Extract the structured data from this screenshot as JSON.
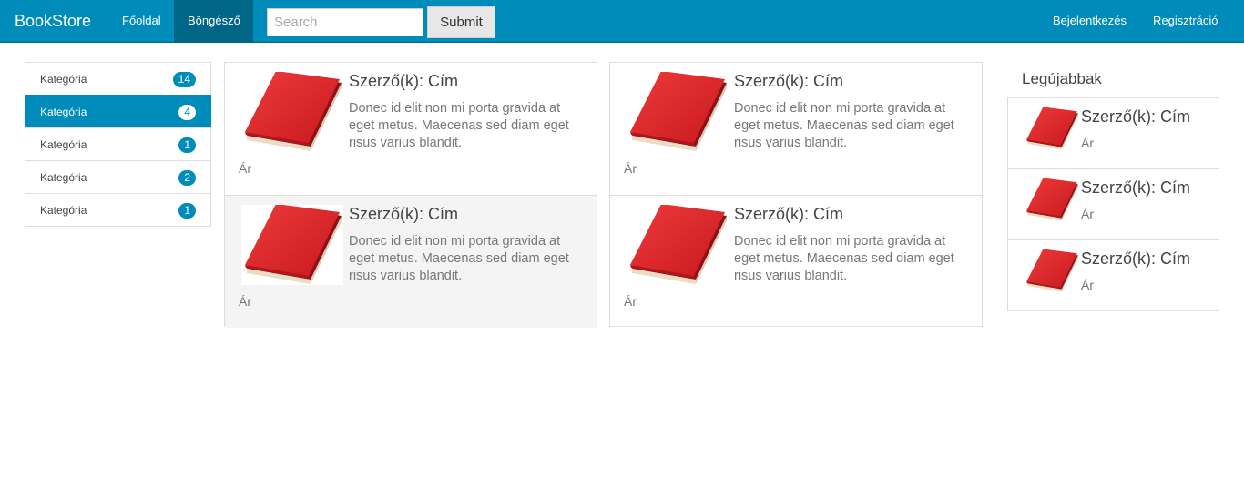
{
  "navbar": {
    "brand": "BookStore",
    "links": [
      "Főoldal",
      "Böngésző"
    ],
    "active_link": "Böngésző",
    "search_placeholder": "Search",
    "search_value": "",
    "submit_label": "Submit",
    "right_links": [
      "Bejelentkezés",
      "Regisztráció"
    ],
    "accent_color": "#008cba"
  },
  "sidebar": {
    "categories": [
      {
        "label": "Kategória",
        "count": "14",
        "active": false
      },
      {
        "label": "Kategória",
        "count": "4",
        "active": true
      },
      {
        "label": "Kategória",
        "count": "1",
        "active": false
      },
      {
        "label": "Kategória",
        "count": "2",
        "active": false
      },
      {
        "label": "Kategória",
        "count": "1",
        "active": false
      }
    ]
  },
  "books": [
    {
      "title": "Szerző(k): Cím",
      "description": "Donec id elit non mi porta gravida at eget metus. Maecenas sed diam eget risus varius blandit.",
      "price": "Ár",
      "image": "red-book-image"
    },
    {
      "title": "Szerző(k): Cím",
      "description": "Donec id elit non mi porta gravida at eget metus. Maecenas sed diam eget risus varius blandit.",
      "price": "Ár",
      "image": "red-book-image"
    },
    {
      "title": "Szerző(k): Cím",
      "description": "Donec id elit non mi porta gravida at eget metus. Maecenas sed diam eget risus varius blandit.",
      "price": "Ár",
      "image": "red-book-image"
    },
    {
      "title": "Szerző(k): Cím",
      "description": "Donec id elit non mi porta gravida at eget metus. Maecenas sed diam eget risus varius blandit.",
      "price": "Ár",
      "image": "red-book-image"
    }
  ],
  "newest": {
    "heading": "Legújabbak",
    "items": [
      {
        "title": "Szerző(k): Cím",
        "price": "Ár"
      },
      {
        "title": "Szerző(k): Cím",
        "price": "Ár"
      },
      {
        "title": "Szerző(k): Cím",
        "price": "Ár"
      }
    ]
  }
}
